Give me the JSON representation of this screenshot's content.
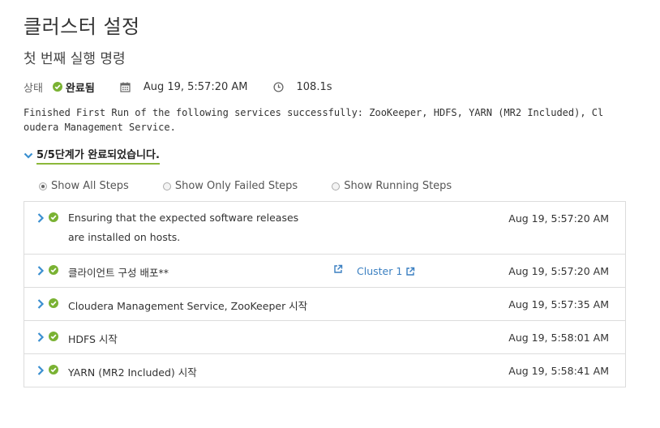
{
  "title": "클러스터 설정",
  "subtitle": "첫 번째 실행 명령",
  "meta": {
    "status_label": "상태",
    "status_value": "완료됨",
    "date": "Aug 19, 5:57:20 AM",
    "duration": "108.1s"
  },
  "message": "Finished First Run of the following services successfully: ZooKeeper, HDFS, YARN (MR2 Included), Cloudera Management Service.",
  "steps_toggle": "5/5단계가 완료되었습니다.",
  "filters": [
    {
      "label": "Show All Steps",
      "selected": true
    },
    {
      "label": "Show Only Failed Steps",
      "selected": false
    },
    {
      "label": "Show Running Steps",
      "selected": false
    }
  ],
  "steps": [
    {
      "name": "Ensuring that the expected software releases are installed on hosts.",
      "time": "Aug 19, 5:57:20 AM"
    },
    {
      "name": "클라이언트 구성 배포**",
      "time": "Aug 19, 5:57:20 AM",
      "link": "Cluster 1"
    },
    {
      "name": "Cloudera Management Service, ZooKeeper 시작",
      "time": "Aug 19, 5:57:35 AM"
    },
    {
      "name": "HDFS 시작",
      "time": "Aug 19, 5:58:01 AM"
    },
    {
      "name": "YARN (MR2 Included) 시작",
      "time": "Aug 19, 5:58:41 AM"
    }
  ],
  "colors": {
    "success": "#7ab233",
    "link": "#3a7fc1",
    "chevron": "#3a8fd0"
  },
  "icons": {
    "status": "check-circle-icon",
    "date": "calendar-icon",
    "duration": "clock-icon",
    "expand": "chevron-right-icon",
    "external": "external-link-icon"
  }
}
